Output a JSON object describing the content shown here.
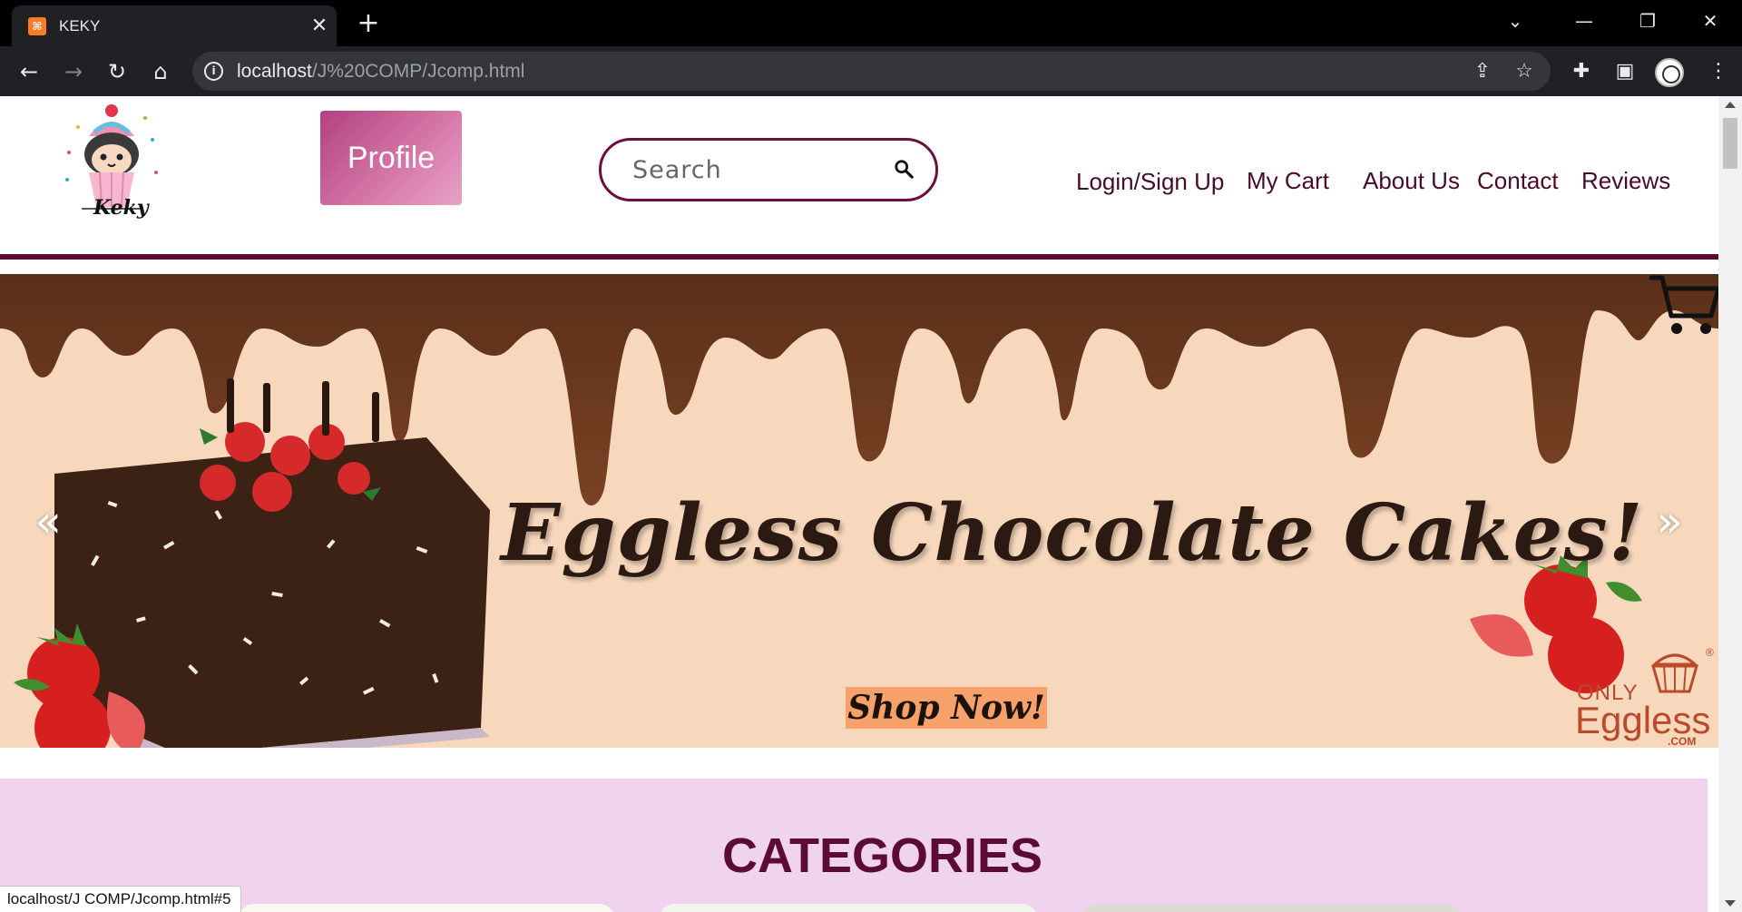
{
  "browser": {
    "tab_title": "KEKY",
    "tab_favicon_text": "⌘",
    "close_glyph": "✕",
    "new_tab_glyph": "+",
    "url_host": "localhost",
    "url_path": "/J%20COMP/Jcomp.html",
    "status_url": "localhost/J COMP/Jcomp.html#5",
    "icons": {
      "back": "←",
      "forward": "→",
      "reload": "↻",
      "home": "⌂",
      "info": "i",
      "share": "⇪",
      "bookmark": "☆",
      "extensions": "✚",
      "sidebar": "▣",
      "menu": "⋮",
      "tab_search": "⌄",
      "minimize": "—",
      "restore": "❐",
      "close": "✕"
    }
  },
  "site": {
    "logo_text": "Keky",
    "profile_label": "Profile",
    "search_placeholder": "Search",
    "nav": [
      {
        "label": "Login/Sign Up"
      },
      {
        "label": "My Cart"
      },
      {
        "label": "About Us"
      },
      {
        "label": "Contact"
      },
      {
        "label": "Reviews"
      }
    ],
    "accent_color": "#5c0b35"
  },
  "banner": {
    "headline": "Eggless Chocolate Cakes!",
    "cta": "Shop Now!",
    "prev_glyph": "«",
    "next_glyph": "»",
    "brand_only": "ONLY",
    "brand_name": "Eggless",
    "brand_suffix": ".COM",
    "brand_mark": "®"
  },
  "categories": {
    "title": "CATEGORIES"
  }
}
